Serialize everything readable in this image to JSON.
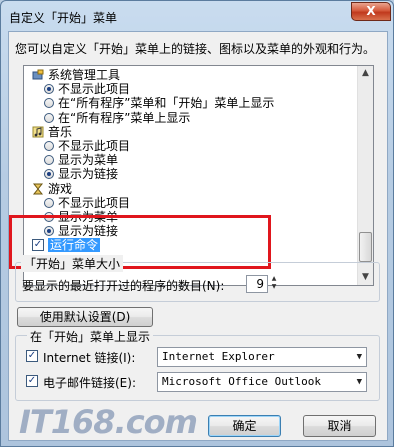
{
  "window": {
    "title": "自定义「开始」菜单",
    "close_label": "X"
  },
  "description": "您可以自定义「开始」菜单上的链接、图标以及菜单的外观和行为。",
  "tree": [
    {
      "type": "category",
      "label": "系统管理工具",
      "icon": "admin-tools-icon"
    },
    {
      "type": "radio",
      "label": "不显示此项目",
      "checked": true
    },
    {
      "type": "radio",
      "label": "在“所有程序”菜单和「开始」菜单上显示",
      "checked": false
    },
    {
      "type": "radio",
      "label": "在“所有程序”菜单上显示",
      "checked": false
    },
    {
      "type": "category",
      "label": "音乐",
      "icon": "music-icon"
    },
    {
      "type": "radio",
      "label": "不显示此项目",
      "checked": false
    },
    {
      "type": "radio",
      "label": "显示为菜单",
      "checked": false
    },
    {
      "type": "radio",
      "label": "显示为链接",
      "checked": true
    },
    {
      "type": "category",
      "label": "游戏",
      "icon": "games-icon"
    },
    {
      "type": "radio",
      "label": "不显示此项目",
      "checked": false
    },
    {
      "type": "radio",
      "label": "显示为菜单",
      "checked": false
    },
    {
      "type": "radio",
      "label": "显示为链接",
      "checked": true
    },
    {
      "type": "checkbox",
      "label": "运行命令",
      "checked": true
    }
  ],
  "menu_size": {
    "group_label": "「开始」菜单大小",
    "recent_label": "要显示的最近打开过的程序的数目(N):",
    "recent_value": "9"
  },
  "defaults_button": "使用默认设置(D)",
  "show_group": {
    "label": "在「开始」菜单上显示",
    "internet_label": "Internet 链接(I):",
    "internet_value": "Internet Explorer",
    "email_label": "电子邮件链接(E):",
    "email_value": "Microsoft Office Outlook"
  },
  "buttons": {
    "ok": "确定",
    "cancel": "取消"
  },
  "watermark": "IT168.com",
  "colors": {
    "highlight": "#e0161d",
    "accent": "#3399ff"
  }
}
